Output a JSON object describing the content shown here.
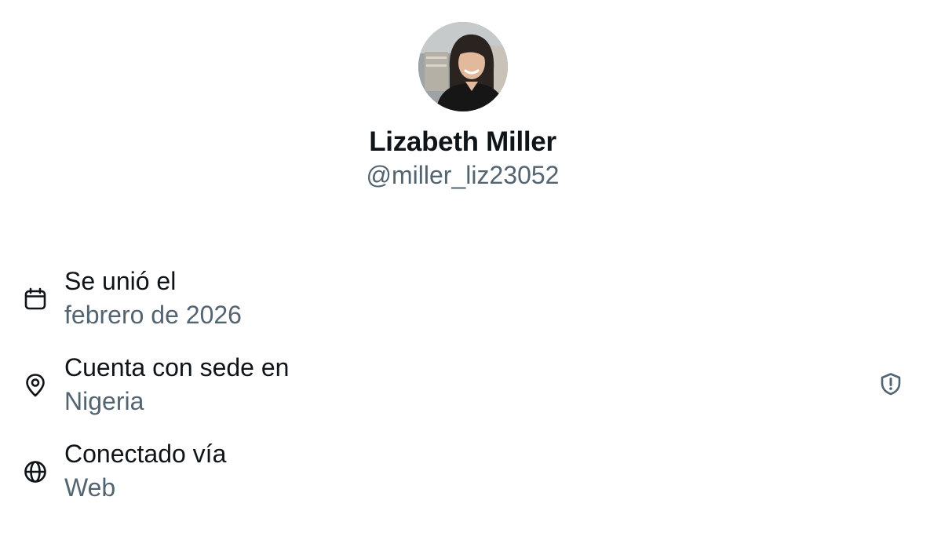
{
  "profile": {
    "display_name": "Lizabeth Miller",
    "handle": "@miller_liz23052"
  },
  "about": {
    "rows": [
      {
        "icon": "calendar-icon",
        "label": "Se unió el",
        "value": "febrero de 2026"
      },
      {
        "icon": "location-pin-icon",
        "label": "Cuenta con sede en",
        "value": "Nigeria",
        "action_icon": "shield-alert-icon"
      },
      {
        "icon": "globe-icon",
        "label": "Conectado vía",
        "value": "Web"
      }
    ]
  },
  "colors": {
    "primary_text": "#0f1419",
    "secondary_text": "#536471",
    "background": "#ffffff"
  }
}
